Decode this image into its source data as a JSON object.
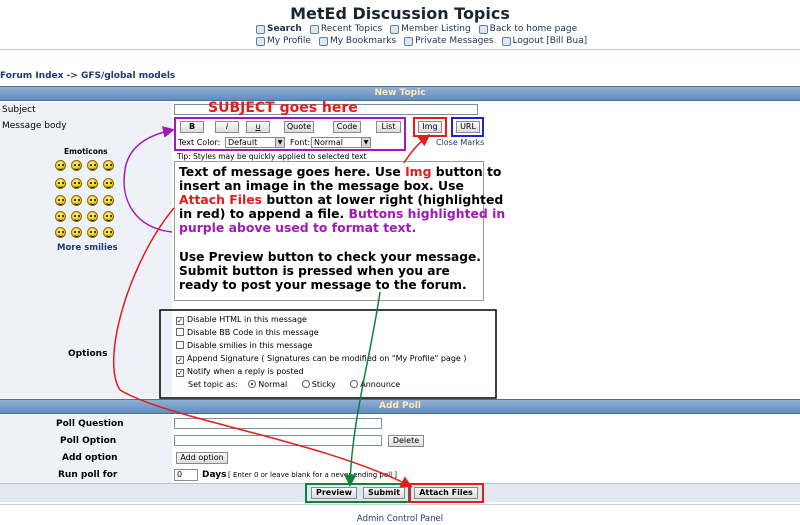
{
  "header": {
    "title": "MetEd Discussion Topics",
    "nav_row1": [
      {
        "label": "Search",
        "icon": "search-icon",
        "bold": true
      },
      {
        "label": "Recent Topics",
        "icon": "topics-icon",
        "bold": false
      },
      {
        "label": "Member Listing",
        "icon": "members-icon",
        "bold": false
      },
      {
        "label": "Back to home page",
        "icon": "home-icon",
        "bold": false
      }
    ],
    "nav_row2": [
      {
        "label": "My Profile",
        "icon": "profile-icon"
      },
      {
        "label": "My Bookmarks",
        "icon": "bookmark-icon"
      },
      {
        "label": "Private Messages",
        "icon": "messages-icon"
      },
      {
        "label": "Logout [Bill Bua]",
        "icon": "logout-icon"
      }
    ]
  },
  "breadcrumb": "Forum Index -> GFS/global models",
  "new_topic": {
    "bar_title": "New Topic",
    "subject_label": "Subject",
    "message_label": "Message body",
    "emoticons_label": "Emoticons",
    "more_smilies": "More smilies",
    "format_buttons": [
      "B",
      "i",
      "u",
      "Quote",
      "Code",
      "List"
    ],
    "img_button": "Img",
    "url_button": "URL",
    "close_marks": "Close Marks",
    "text_color_label": "Text Color:",
    "text_color_value": "Default",
    "font_label": "Font:",
    "font_value": "Normal",
    "tip": "Tip: Styles may be quickly applied to selected text",
    "options_label": "Options",
    "options": [
      {
        "label": "Disable HTML in this message",
        "checked": true
      },
      {
        "label": "Disable BB Code in this message",
        "checked": false
      },
      {
        "label": "Disable smilies in this message",
        "checked": false
      },
      {
        "label": "Append Signature ( Signatures can be modified on \"My Profile\" page )",
        "checked": true
      },
      {
        "label": "Notify when a reply is posted",
        "checked": true
      }
    ],
    "set_topic_label": "Set topic as:",
    "topic_types": [
      {
        "label": "Normal",
        "selected": true
      },
      {
        "label": "Sticky",
        "selected": false
      },
      {
        "label": "Announce",
        "selected": false
      }
    ]
  },
  "poll": {
    "bar_title": "Add Poll",
    "question_label": "Poll Question",
    "option_label": "Poll Option",
    "delete_button": "Delete",
    "add_option_label": "Add option",
    "add_option_button": "Add option",
    "run_for_label": "Run poll for",
    "run_for_value": "0",
    "days_label": "Days",
    "days_hint": "[ Enter 0 or leave blank for a never-ending poll ]"
  },
  "actions": {
    "preview": "Preview",
    "submit": "Submit",
    "attach": "Attach Files"
  },
  "footer": {
    "admin_link": "Admin Control Panel"
  },
  "annotations": {
    "subject_note": "SUBJECT goes here",
    "message_text": {
      "p1_a": "Text of message goes here. Use ",
      "p1_img": "Img",
      "p1_b": " button to insert an image in the message box. Use ",
      "p1_attach": "Attach Files",
      "p1_c": " button at lower right (highlighted in red) to append a file. ",
      "p1_purple": "Buttons highlighted in purple above used to format text.",
      "p2": "Use Preview button to check your message. Submit button is pressed when you are ready to post your message to the forum."
    },
    "colors": {
      "red": "#e41c1c",
      "purple": "#a01ab8",
      "green": "#10823a",
      "blue": "#1f22d6"
    }
  }
}
